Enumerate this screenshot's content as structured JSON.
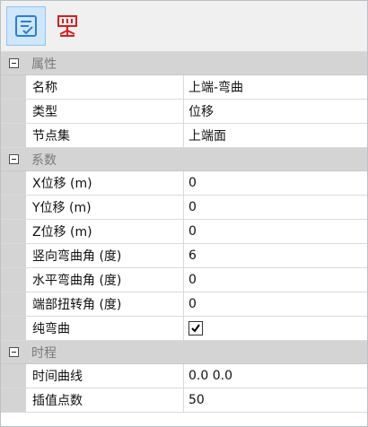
{
  "toolbar": {
    "buttons": [
      {
        "icon": "property-edit-icon",
        "active": true,
        "color": "#2b7fd6"
      },
      {
        "icon": "load-structure-icon",
        "active": false,
        "color": "#d81e1e"
      }
    ]
  },
  "sections": [
    {
      "label": "属性",
      "rows": [
        {
          "name": "名称",
          "value": "上端-弯曲"
        },
        {
          "name": "类型",
          "value": "位移"
        },
        {
          "name": "节点集",
          "value": "上端面"
        }
      ]
    },
    {
      "label": "系数",
      "rows": [
        {
          "name": "X位移 (m)",
          "value": "0"
        },
        {
          "name": "Y位移 (m)",
          "value": "0"
        },
        {
          "name": "Z位移 (m)",
          "value": "0"
        },
        {
          "name": "竖向弯曲角 (度)",
          "value": "6"
        },
        {
          "name": "水平弯曲角 (度)",
          "value": "0"
        },
        {
          "name": "端部扭转角 (度)",
          "value": "0"
        },
        {
          "name": "纯弯曲",
          "value": "",
          "checked": true
        }
      ]
    },
    {
      "label": "时程",
      "rows": [
        {
          "name": "时间曲线",
          "value": "0.0 0.0"
        },
        {
          "name": "插值点数",
          "value": "50"
        }
      ]
    }
  ]
}
